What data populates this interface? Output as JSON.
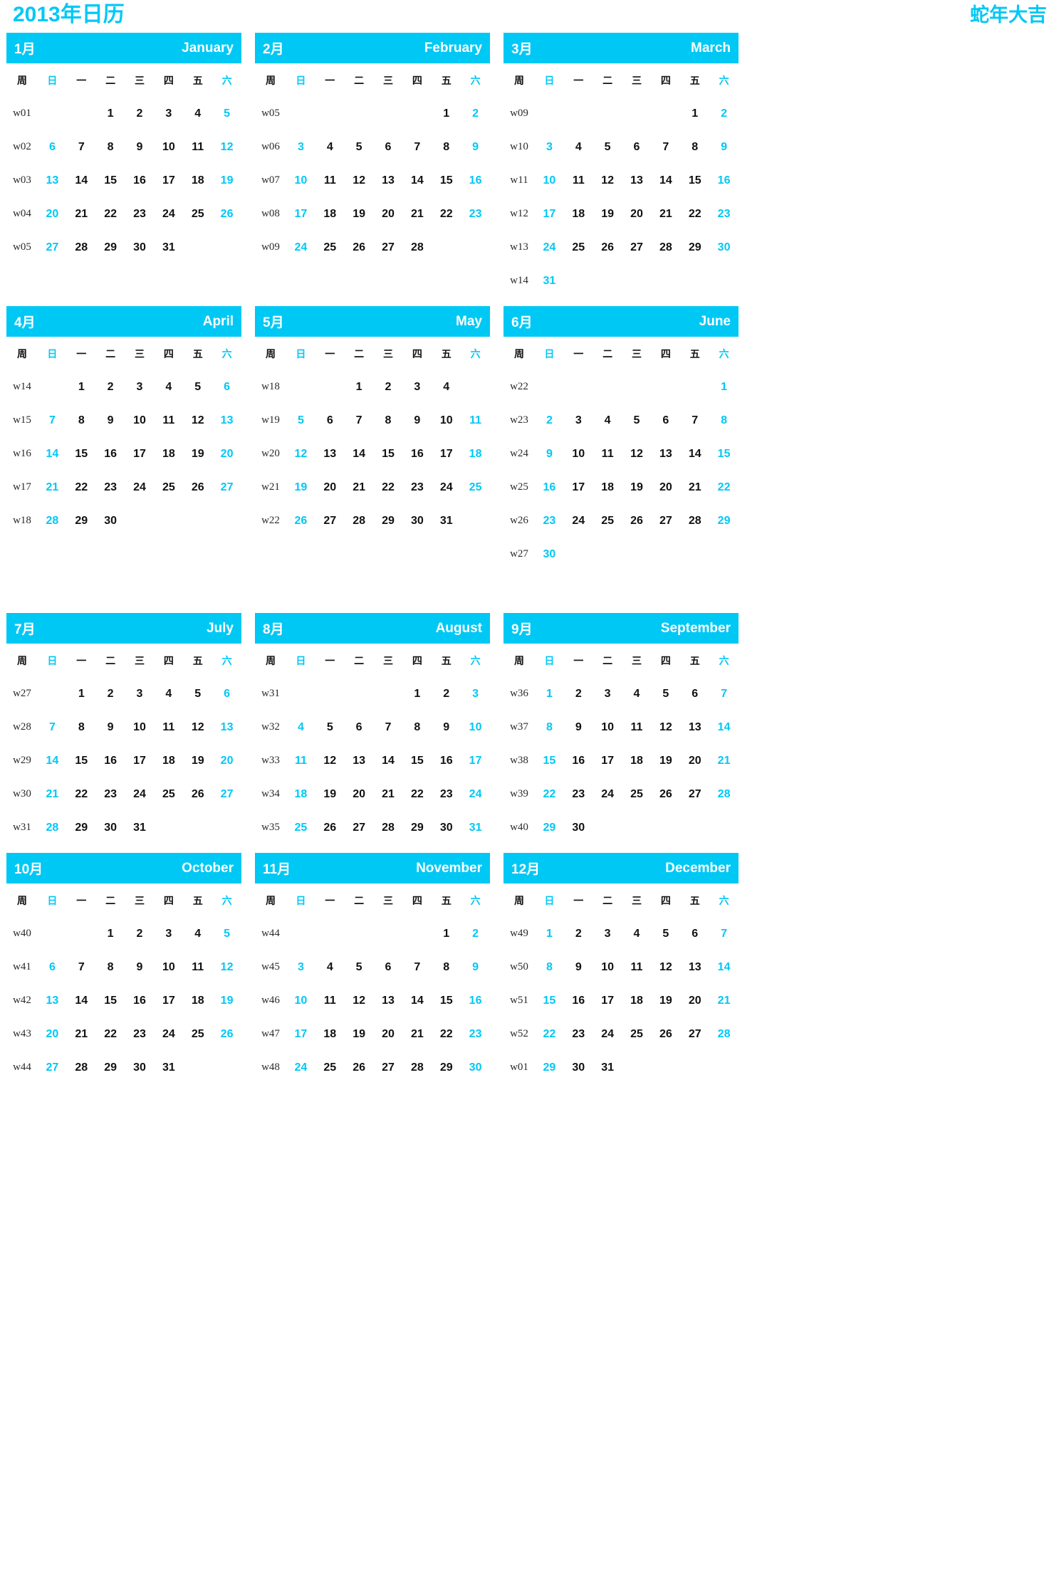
{
  "header": {
    "title_left": "2013年日历",
    "title_right": "蛇年大吉"
  },
  "theme": {
    "accent": "#00c8f5",
    "text": "#111111",
    "week_number": "#2b2b2b",
    "background": "#ffffff"
  },
  "weekday_headers": {
    "week_label": "周",
    "days": [
      "日",
      "一",
      "二",
      "三",
      "四",
      "五",
      "六"
    ],
    "highlight_indices": [
      0,
      6
    ]
  },
  "months": [
    {
      "cn": "1月",
      "en": "January",
      "weeks": [
        {
          "w": "w01",
          "days": [
            "",
            "",
            "1",
            "2",
            "3",
            "4",
            "5"
          ]
        },
        {
          "w": "w02",
          "days": [
            "6",
            "7",
            "8",
            "9",
            "10",
            "11",
            "12"
          ]
        },
        {
          "w": "w03",
          "days": [
            "13",
            "14",
            "15",
            "16",
            "17",
            "18",
            "19"
          ]
        },
        {
          "w": "w04",
          "days": [
            "20",
            "21",
            "22",
            "23",
            "24",
            "25",
            "26"
          ]
        },
        {
          "w": "w05",
          "days": [
            "27",
            "28",
            "29",
            "30",
            "31",
            "",
            ""
          ]
        }
      ]
    },
    {
      "cn": "2月",
      "en": "February",
      "weeks": [
        {
          "w": "w05",
          "days": [
            "",
            "",
            "",
            "",
            "",
            "1",
            "2"
          ]
        },
        {
          "w": "w06",
          "days": [
            "3",
            "4",
            "5",
            "6",
            "7",
            "8",
            "9"
          ]
        },
        {
          "w": "w07",
          "days": [
            "10",
            "11",
            "12",
            "13",
            "14",
            "15",
            "16"
          ]
        },
        {
          "w": "w08",
          "days": [
            "17",
            "18",
            "19",
            "20",
            "21",
            "22",
            "23"
          ]
        },
        {
          "w": "w09",
          "days": [
            "24",
            "25",
            "26",
            "27",
            "28",
            "",
            ""
          ]
        }
      ]
    },
    {
      "cn": "3月",
      "en": "March",
      "weeks": [
        {
          "w": "w09",
          "days": [
            "",
            "",
            "",
            "",
            "",
            "1",
            "2"
          ]
        },
        {
          "w": "w10",
          "days": [
            "3",
            "4",
            "5",
            "6",
            "7",
            "8",
            "9"
          ]
        },
        {
          "w": "w11",
          "days": [
            "10",
            "11",
            "12",
            "13",
            "14",
            "15",
            "16"
          ]
        },
        {
          "w": "w12",
          "days": [
            "17",
            "18",
            "19",
            "20",
            "21",
            "22",
            "23"
          ]
        },
        {
          "w": "w13",
          "days": [
            "24",
            "25",
            "26",
            "27",
            "28",
            "29",
            "30"
          ]
        },
        {
          "w": "w14",
          "days": [
            "31",
            "",
            "",
            "",
            "",
            "",
            ""
          ]
        }
      ]
    },
    {
      "cn": "4月",
      "en": "April",
      "weeks": [
        {
          "w": "w14",
          "days": [
            "",
            "1",
            "2",
            "3",
            "4",
            "5",
            "6"
          ]
        },
        {
          "w": "w15",
          "days": [
            "7",
            "8",
            "9",
            "10",
            "11",
            "12",
            "13"
          ]
        },
        {
          "w": "w16",
          "days": [
            "14",
            "15",
            "16",
            "17",
            "18",
            "19",
            "20"
          ]
        },
        {
          "w": "w17",
          "days": [
            "21",
            "22",
            "23",
            "24",
            "25",
            "26",
            "27"
          ]
        },
        {
          "w": "w18",
          "days": [
            "28",
            "29",
            "30",
            "",
            "",
            "",
            ""
          ]
        }
      ]
    },
    {
      "cn": "5月",
      "en": "May",
      "weeks": [
        {
          "w": "w18",
          "days": [
            "",
            "",
            "1",
            "2",
            "3",
            "4",
            ""
          ]
        },
        {
          "w": "w19",
          "days": [
            "5",
            "6",
            "7",
            "8",
            "9",
            "10",
            "11"
          ]
        },
        {
          "w": "w20",
          "days": [
            "12",
            "13",
            "14",
            "15",
            "16",
            "17",
            "18"
          ]
        },
        {
          "w": "w21",
          "days": [
            "19",
            "20",
            "21",
            "22",
            "23",
            "24",
            "25"
          ]
        },
        {
          "w": "w22",
          "days": [
            "26",
            "27",
            "28",
            "29",
            "30",
            "31",
            ""
          ]
        }
      ]
    },
    {
      "cn": "6月",
      "en": "June",
      "weeks": [
        {
          "w": "w22",
          "days": [
            "",
            "",
            "",
            "",
            "",
            "",
            "1"
          ]
        },
        {
          "w": "w23",
          "days": [
            "2",
            "3",
            "4",
            "5",
            "6",
            "7",
            "8"
          ]
        },
        {
          "w": "w24",
          "days": [
            "9",
            "10",
            "11",
            "12",
            "13",
            "14",
            "15"
          ]
        },
        {
          "w": "w25",
          "days": [
            "16",
            "17",
            "18",
            "19",
            "20",
            "21",
            "22"
          ]
        },
        {
          "w": "w26",
          "days": [
            "23",
            "24",
            "25",
            "26",
            "27",
            "28",
            "29"
          ]
        },
        {
          "w": "w27",
          "days": [
            "30",
            "",
            "",
            "",
            "",
            "",
            ""
          ]
        }
      ]
    },
    {
      "cn": "7月",
      "en": "July",
      "weeks": [
        {
          "w": "w27",
          "days": [
            "",
            "1",
            "2",
            "3",
            "4",
            "5",
            "6"
          ]
        },
        {
          "w": "w28",
          "days": [
            "7",
            "8",
            "9",
            "10",
            "11",
            "12",
            "13"
          ]
        },
        {
          "w": "w29",
          "days": [
            "14",
            "15",
            "16",
            "17",
            "18",
            "19",
            "20"
          ]
        },
        {
          "w": "w30",
          "days": [
            "21",
            "22",
            "23",
            "24",
            "25",
            "26",
            "27"
          ]
        },
        {
          "w": "w31",
          "days": [
            "28",
            "29",
            "30",
            "31",
            "",
            "",
            ""
          ]
        }
      ]
    },
    {
      "cn": "8月",
      "en": "August",
      "weeks": [
        {
          "w": "w31",
          "days": [
            "",
            "",
            "",
            "",
            "1",
            "2",
            "3"
          ]
        },
        {
          "w": "w32",
          "days": [
            "4",
            "5",
            "6",
            "7",
            "8",
            "9",
            "10"
          ]
        },
        {
          "w": "w33",
          "days": [
            "11",
            "12",
            "13",
            "14",
            "15",
            "16",
            "17"
          ]
        },
        {
          "w": "w34",
          "days": [
            "18",
            "19",
            "20",
            "21",
            "22",
            "23",
            "24"
          ]
        },
        {
          "w": "w35",
          "days": [
            "25",
            "26",
            "27",
            "28",
            "29",
            "30",
            "31"
          ]
        }
      ]
    },
    {
      "cn": "9月",
      "en": "September",
      "weeks": [
        {
          "w": "w36",
          "days": [
            "1",
            "2",
            "3",
            "4",
            "5",
            "6",
            "7"
          ]
        },
        {
          "w": "w37",
          "days": [
            "8",
            "9",
            "10",
            "11",
            "12",
            "13",
            "14"
          ]
        },
        {
          "w": "w38",
          "days": [
            "15",
            "16",
            "17",
            "18",
            "19",
            "20",
            "21"
          ]
        },
        {
          "w": "w39",
          "days": [
            "22",
            "23",
            "24",
            "25",
            "26",
            "27",
            "28"
          ]
        },
        {
          "w": "w40",
          "days": [
            "29",
            "30",
            "",
            "",
            "",
            "",
            ""
          ]
        }
      ]
    },
    {
      "cn": "10月",
      "en": "October",
      "weeks": [
        {
          "w": "w40",
          "days": [
            "",
            "",
            "1",
            "2",
            "3",
            "4",
            "5"
          ]
        },
        {
          "w": "w41",
          "days": [
            "6",
            "7",
            "8",
            "9",
            "10",
            "11",
            "12"
          ]
        },
        {
          "w": "w42",
          "days": [
            "13",
            "14",
            "15",
            "16",
            "17",
            "18",
            "19"
          ]
        },
        {
          "w": "w43",
          "days": [
            "20",
            "21",
            "22",
            "23",
            "24",
            "25",
            "26"
          ]
        },
        {
          "w": "w44",
          "days": [
            "27",
            "28",
            "29",
            "30",
            "31",
            "",
            ""
          ]
        }
      ]
    },
    {
      "cn": "11月",
      "en": "November",
      "weeks": [
        {
          "w": "w44",
          "days": [
            "",
            "",
            "",
            "",
            "",
            "1",
            "2"
          ]
        },
        {
          "w": "w45",
          "days": [
            "3",
            "4",
            "5",
            "6",
            "7",
            "8",
            "9"
          ]
        },
        {
          "w": "w46",
          "days": [
            "10",
            "11",
            "12",
            "13",
            "14",
            "15",
            "16"
          ]
        },
        {
          "w": "w47",
          "days": [
            "17",
            "18",
            "19",
            "20",
            "21",
            "22",
            "23"
          ]
        },
        {
          "w": "w48",
          "days": [
            "24",
            "25",
            "26",
            "27",
            "28",
            "29",
            "30"
          ]
        }
      ]
    },
    {
      "cn": "12月",
      "en": "December",
      "weeks": [
        {
          "w": "w49",
          "days": [
            "1",
            "2",
            "3",
            "4",
            "5",
            "6",
            "7"
          ]
        },
        {
          "w": "w50",
          "days": [
            "8",
            "9",
            "10",
            "11",
            "12",
            "13",
            "14"
          ]
        },
        {
          "w": "w51",
          "days": [
            "15",
            "16",
            "17",
            "18",
            "19",
            "20",
            "21"
          ]
        },
        {
          "w": "w52",
          "days": [
            "22",
            "23",
            "24",
            "25",
            "26",
            "27",
            "28"
          ]
        },
        {
          "w": "w01",
          "days": [
            "29",
            "30",
            "31",
            "",
            "",
            "",
            ""
          ]
        }
      ]
    }
  ]
}
